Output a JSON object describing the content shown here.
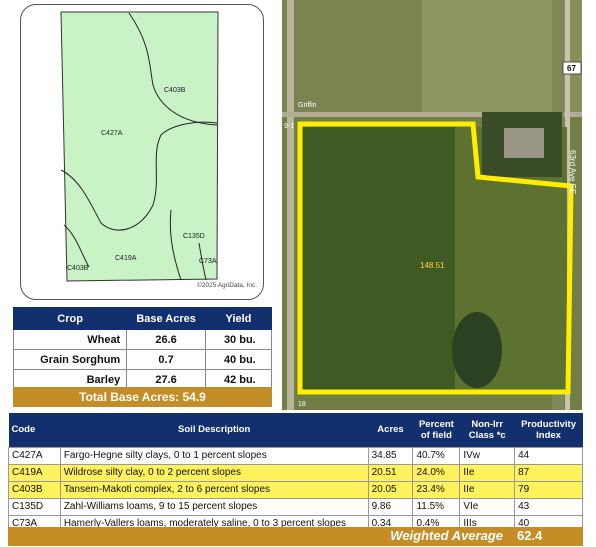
{
  "soil_map": {
    "labels": [
      "C403B",
      "C427A",
      "C135D",
      "C419A",
      "C403B",
      "C73A"
    ],
    "copyright": "©2025 AgriData, Inc."
  },
  "crops": {
    "headers": [
      "Crop",
      "Base Acres",
      "Yield"
    ],
    "rows": [
      {
        "crop": "Wheat",
        "acres": "26.6",
        "yield": "30  bu."
      },
      {
        "crop": "Grain Sorghum",
        "acres": "0.7",
        "yield": "40 bu."
      },
      {
        "crop": "Barley",
        "acres": "27.6",
        "yield": "42 bu."
      }
    ],
    "total": "Total Base Acres:  54.9"
  },
  "aerial": {
    "road_label": "63rd Ave SE",
    "highway": "67",
    "place": "Griffin",
    "road_edge": "9-1",
    "acreage": "148.51",
    "bottom_mark": "18"
  },
  "soils": {
    "headers": {
      "code": "Code",
      "desc": "Soil Description",
      "acres": "Acres",
      "pct": "Percent of field",
      "class": "Non-Irr Class *c",
      "index": "Productivity Index"
    },
    "rows": [
      {
        "code": "C427A",
        "desc": "Fargo-Hegne silty clays, 0 to 1 percent slopes",
        "acres": "34.85",
        "pct": "40.7%",
        "class": "IVw",
        "index": "44"
      },
      {
        "code": "C419A",
        "desc": "Wildrose silty clay, 0 to 2 percent slopes",
        "acres": "20.51",
        "pct": "24.0%",
        "class": "IIe",
        "index": "87"
      },
      {
        "code": "C403B",
        "desc": "Tansem-Makoti complex, 2 to 6 percent slopes",
        "acres": "20.05",
        "pct": "23.4%",
        "class": "IIe",
        "index": "79"
      },
      {
        "code": "C135D",
        "desc": "Zahl-Williams loams, 9 to 15 percent slopes",
        "acres": "9.86",
        "pct": "11.5%",
        "class": "VIe",
        "index": "43"
      },
      {
        "code": "C73A",
        "desc": "Hamerly-Vallers loams, moderately saline, 0 to 3 percent slopes",
        "acres": "0.34",
        "pct": "0.4%",
        "class": "IIIs",
        "index": "40"
      }
    ],
    "weighted_label": "Weighted Average",
    "weighted_value": "62.4"
  },
  "colors": {
    "navy": "#12306e",
    "gold": "#c48d25",
    "highlight": "#fff25c",
    "soil_fill": "#c9f2c6",
    "boundary": "#ffee00"
  }
}
